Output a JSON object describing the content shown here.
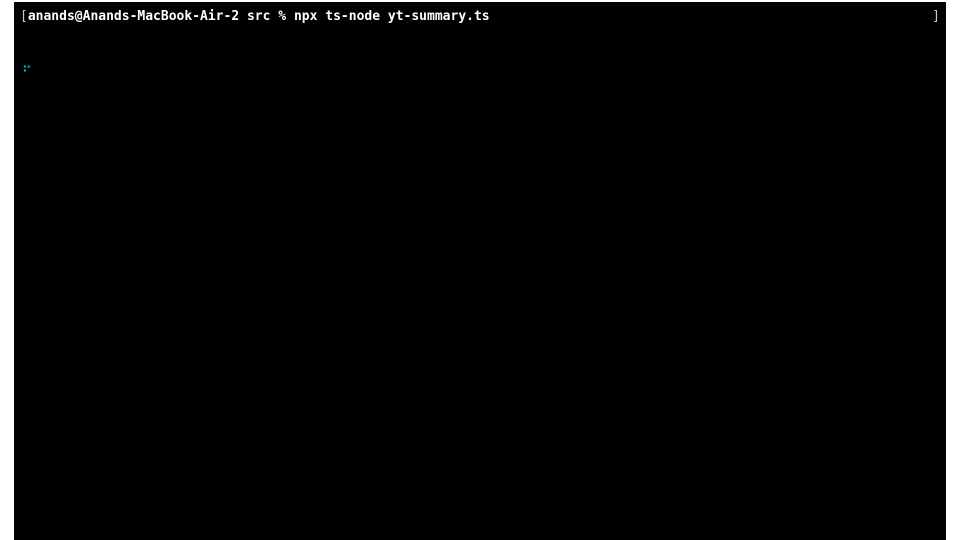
{
  "terminal": {
    "prompt": {
      "open_bracket": "[",
      "user_host": "anands@Anands-MacBook-Air-2",
      "dir": "src",
      "symbol": "%",
      "command": "npx ts-node yt-summary.ts",
      "close_bracket": "]"
    },
    "spinner_glyph": "⠋"
  }
}
